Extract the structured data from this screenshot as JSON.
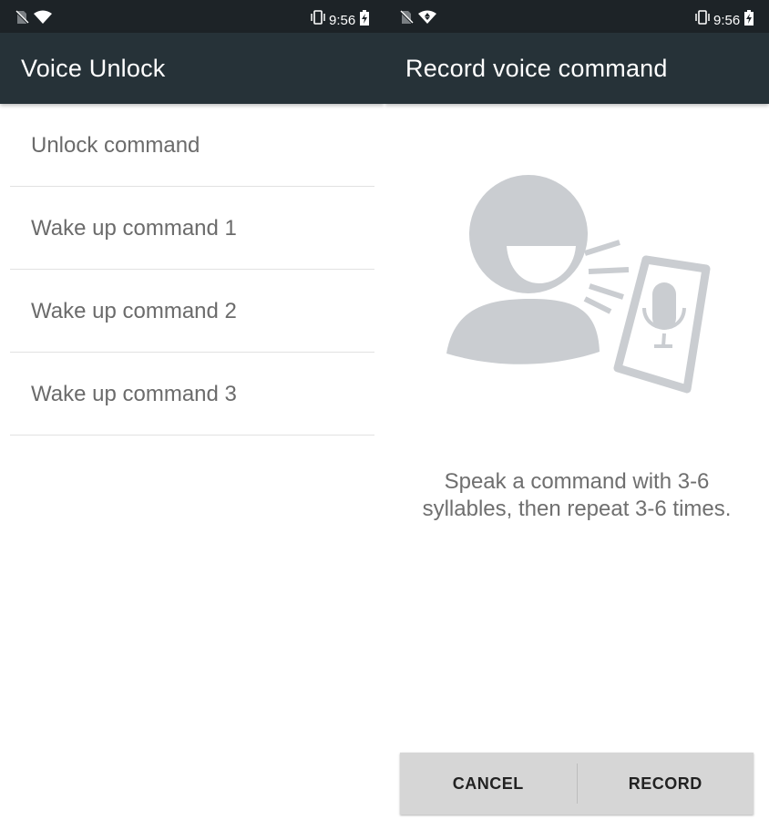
{
  "left": {
    "status": {
      "time": "9:56"
    },
    "appbar": {
      "title": "Voice Unlock"
    },
    "items": [
      {
        "label": "Unlock command"
      },
      {
        "label": "Wake up command 1"
      },
      {
        "label": "Wake up command 2"
      },
      {
        "label": "Wake up command 3"
      }
    ]
  },
  "right": {
    "status": {
      "time": "9:56"
    },
    "appbar": {
      "title": "Record voice command"
    },
    "illustration": {
      "icon": "speaking-person-phone-mic-icon"
    },
    "instruction": {
      "line1": "Speak a command with 3-6",
      "line2": "syllables, then repeat 3-6 times."
    },
    "buttons": {
      "cancel": "CANCEL",
      "record": "RECORD"
    }
  },
  "colors": {
    "statusbar": "#1d2327",
    "appbar": "#263238",
    "illustration": "#cacdd1",
    "buttonbar": "#d6d6d6"
  }
}
